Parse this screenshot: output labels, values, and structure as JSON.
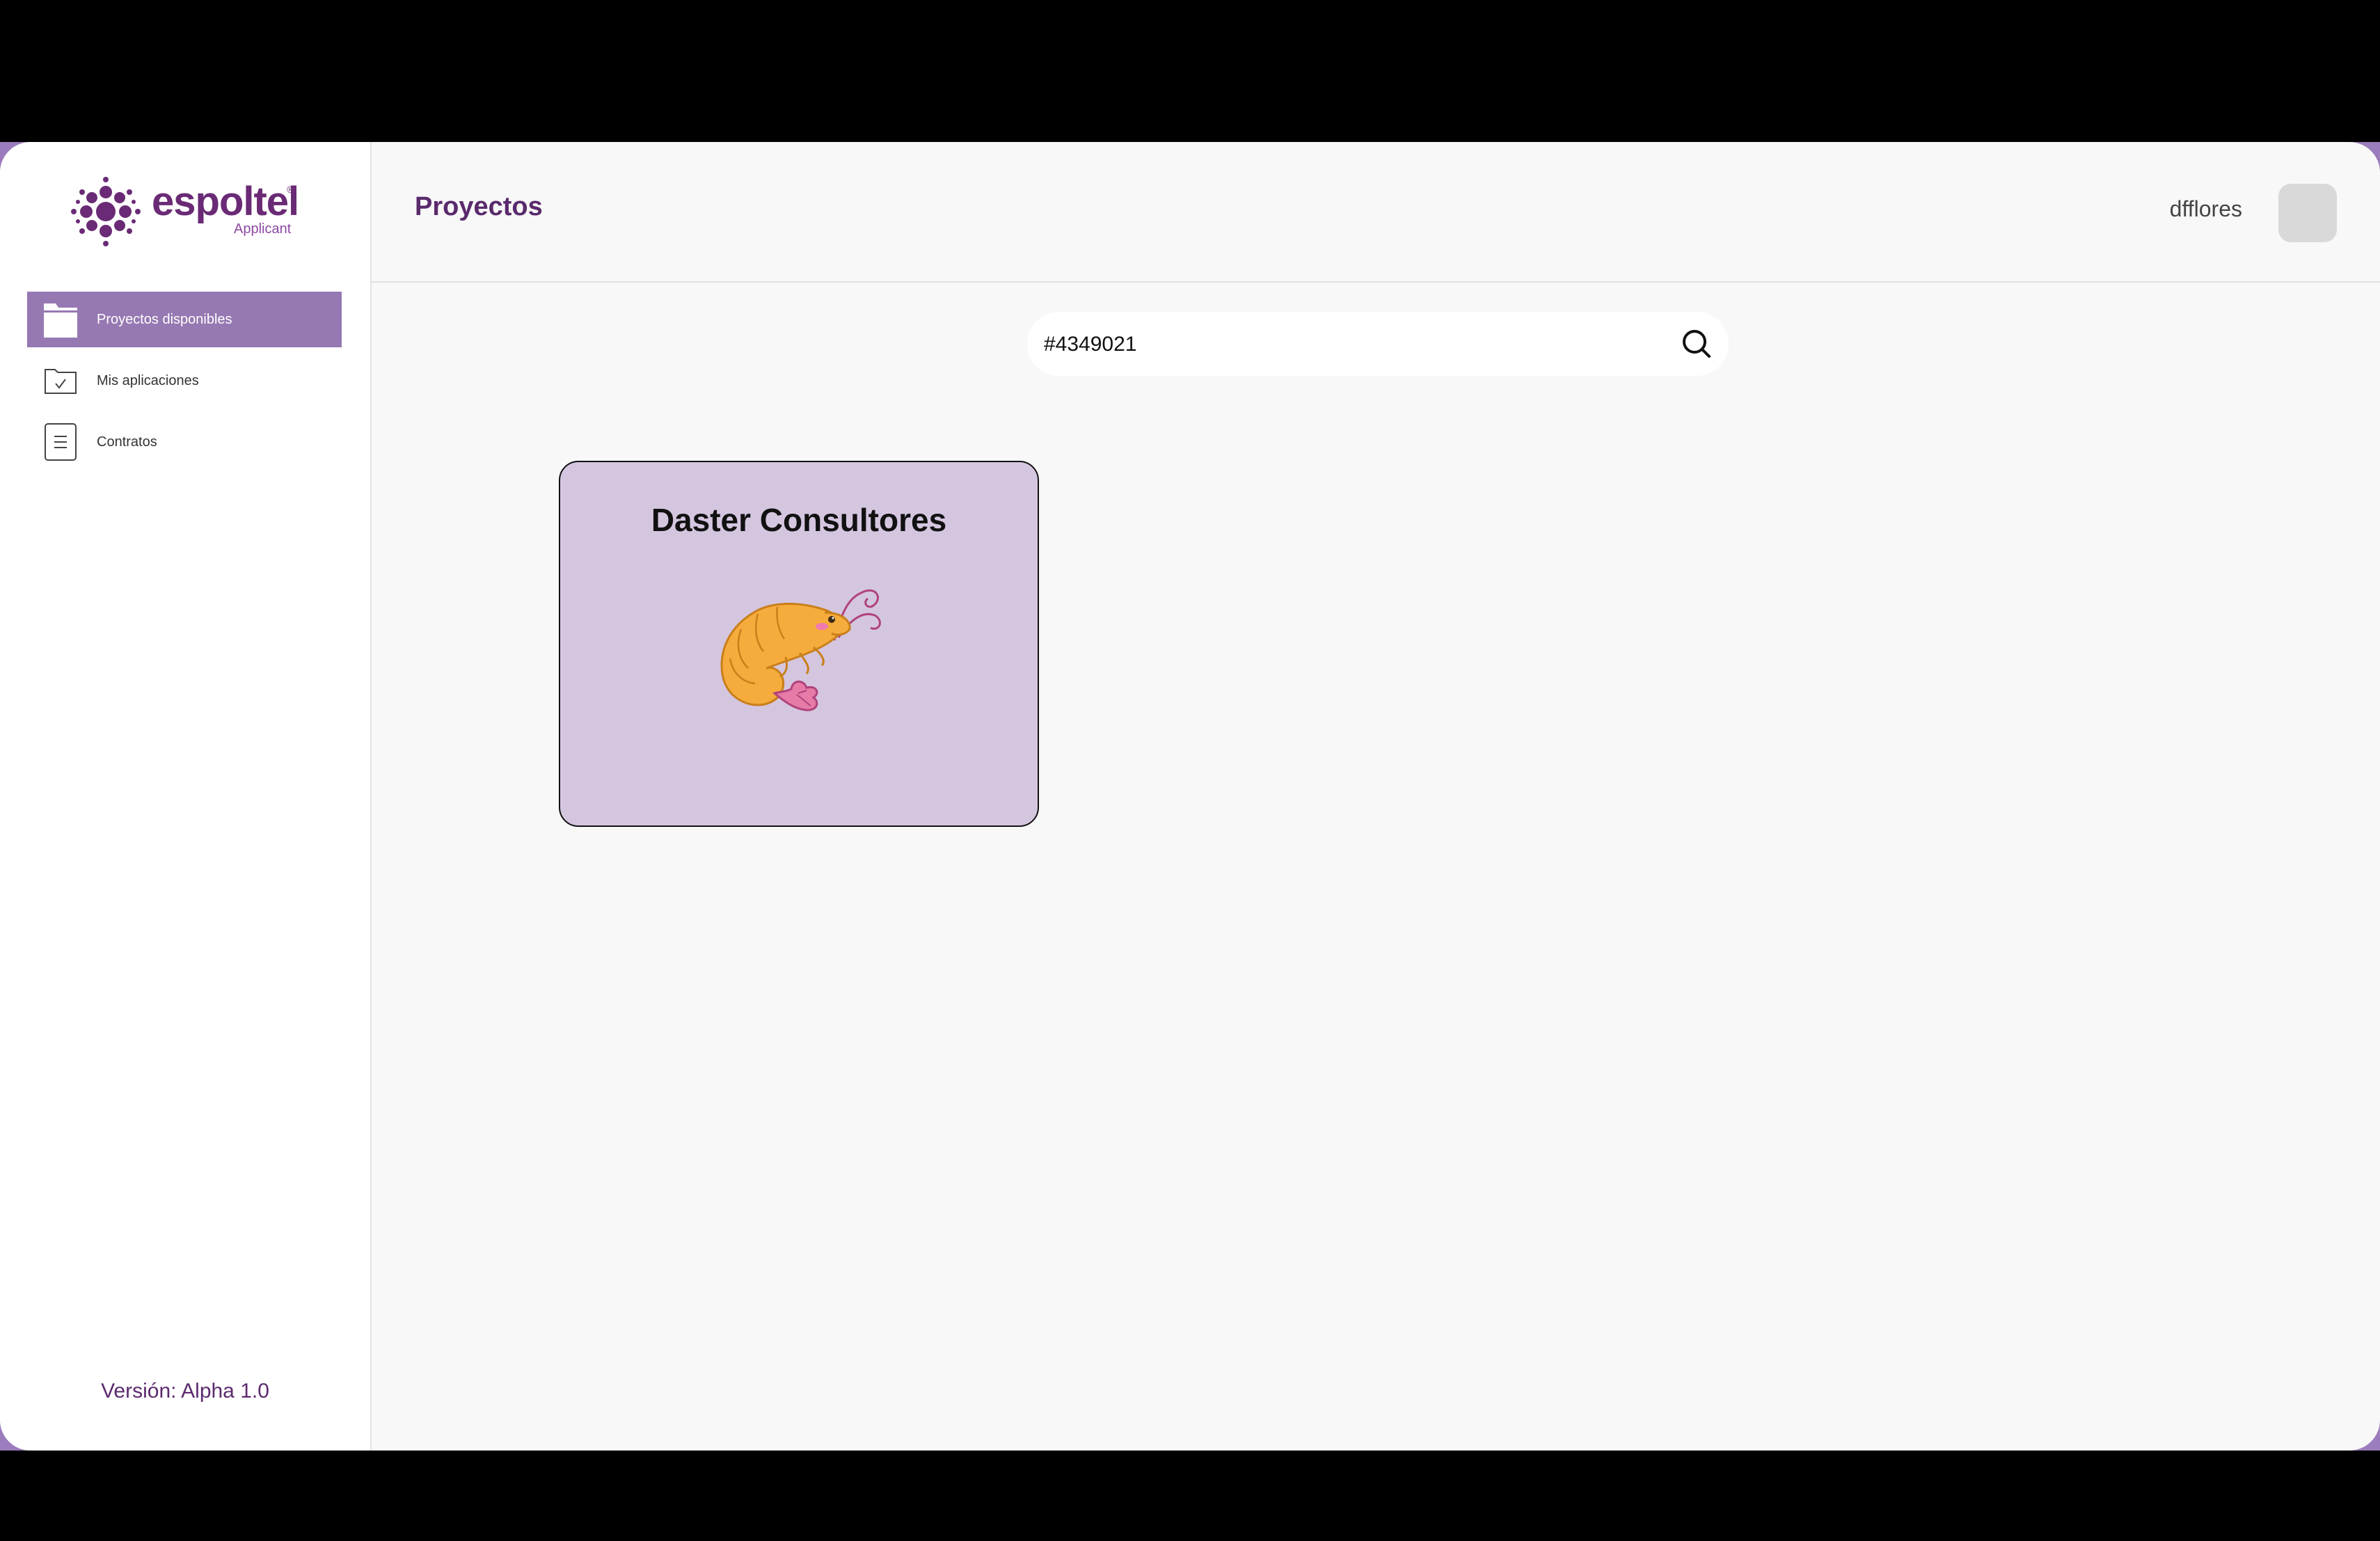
{
  "app": {
    "brand": "espoltel",
    "brand_reg": "®",
    "brand_sub": "Applicant",
    "version": "Versión: Alpha 1.0"
  },
  "colors": {
    "brand": "#6a2a75",
    "active_nav": "#9678b2",
    "card_bg": "#d5c6e0",
    "page_bg": "#f8f8f8"
  },
  "sidebar": {
    "items": [
      {
        "label": "Proyectos disponibles",
        "icon": "folder-icon",
        "active": true
      },
      {
        "label": "Mis aplicaciones",
        "icon": "folder-check-icon",
        "active": false
      },
      {
        "label": "Contratos",
        "icon": "document-icon",
        "active": false
      }
    ]
  },
  "header": {
    "title": "Proyectos",
    "username": "dfflores"
  },
  "search": {
    "value": "#4349021",
    "icon": "search-icon"
  },
  "projects": [
    {
      "title": "Daster Consultores",
      "image": "shrimp-illustration"
    }
  ]
}
